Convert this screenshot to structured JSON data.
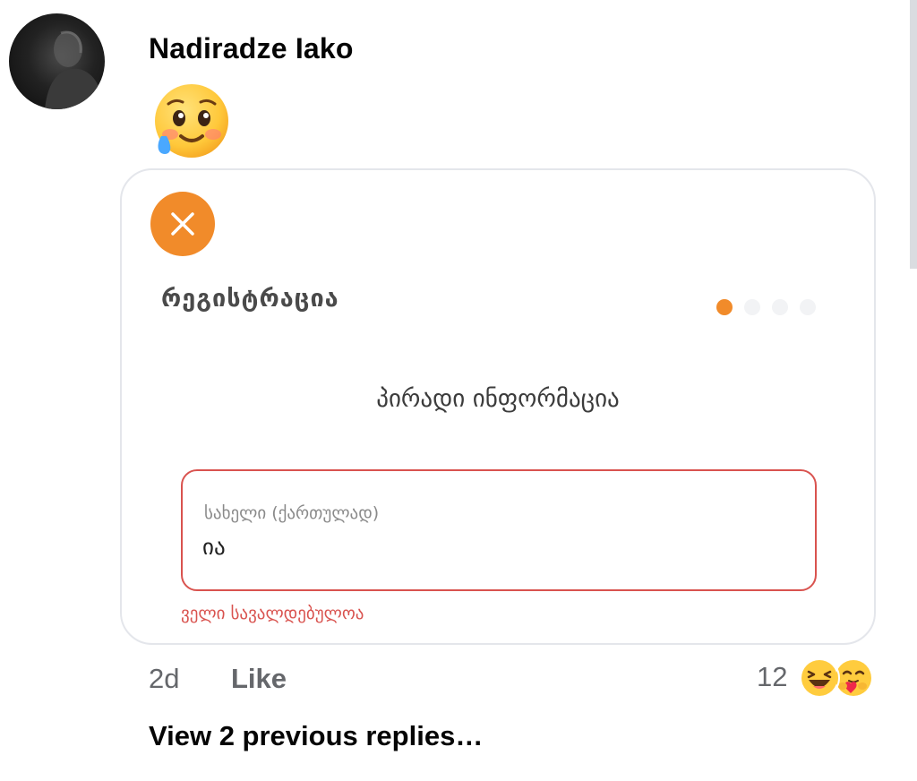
{
  "comment": {
    "author": "Nadiradze Iako",
    "avatar_icon": "profile-photo",
    "reaction_emoji_icon": "face-holding-back-tears-icon"
  },
  "card": {
    "close_icon": "close-icon",
    "title": "რეგისტრაცია",
    "progress": {
      "steps": 4,
      "current": 1
    },
    "section_title": "პირადი ინფორმაცია",
    "field": {
      "label": "სახელი (ქართულად)",
      "value": "ია",
      "error": "ველი სავალდებულოა"
    },
    "colors": {
      "accent": "#f18b2a",
      "error": "#d9534f"
    }
  },
  "meta": {
    "time": "2d",
    "like_label": "Like",
    "reaction_count": "12",
    "reaction_icons": [
      "laughing-face-icon",
      "care-face-icon"
    ]
  },
  "view_replies": "View 2 previous replies…"
}
